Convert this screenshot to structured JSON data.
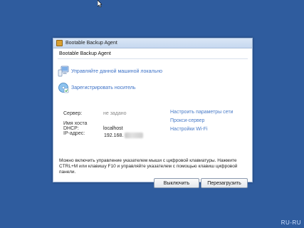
{
  "window": {
    "title": "Bootable Backup Agent",
    "subtitle": "Bootable Backup Agent"
  },
  "actions": {
    "manage_local": "Управляйте данной машиной локально",
    "register_media": "Зарегистрировать носитель"
  },
  "info": {
    "server_label": "Сервер:",
    "server_value": "не задано",
    "dhcp_label": "Имя хоста DHCP:",
    "dhcp_value": "localhost",
    "ip_label": "IP-адрес:",
    "ip_value": "192.168."
  },
  "links": {
    "network": "Настроить параметры сети",
    "proxy": "Прокси-сервер",
    "wifi": "Настройки Wi-Fi"
  },
  "help_text": "Можно включить управление указателем мыши с цифровой клавиатуры. Нажмите CTRL+M или клавишу F10 и управляйте указателем с помощью клавиш цифровой панели.",
  "buttons": {
    "shutdown": "Выключить",
    "reboot": "Перезагрузить"
  },
  "watermark": "RU-RU"
}
